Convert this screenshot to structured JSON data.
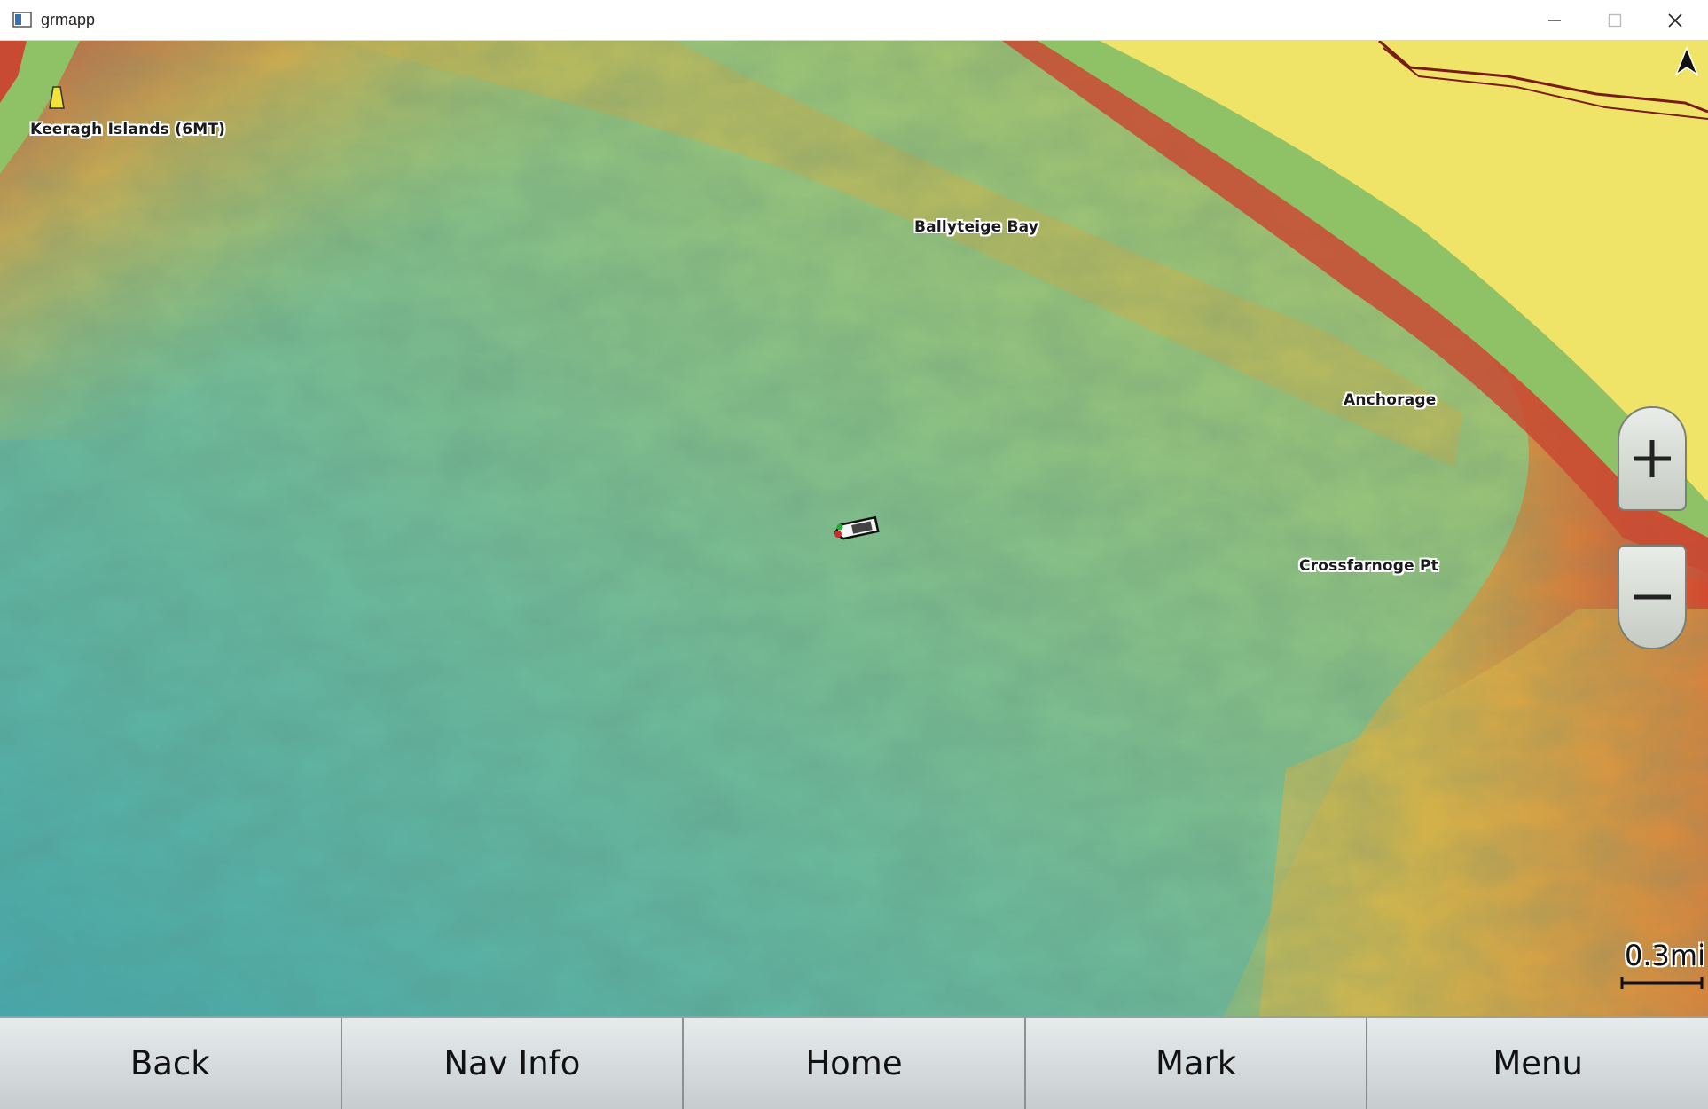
{
  "window": {
    "title": "grmapp",
    "icon": "app-window-icon",
    "controls": [
      "minimize-icon",
      "maximize-icon",
      "close-icon"
    ]
  },
  "map": {
    "labels": {
      "keeragh": "Keeragh Islands (6MT)",
      "ballyteige": "Ballyteige Bay",
      "anchorage": "Anchorage",
      "crossfarnoge": "Crossfarnoge Pt"
    },
    "north_indicator": "north-arrow-icon",
    "vessel": "boat-icon",
    "scale": "0.3mi",
    "colors": {
      "land": "#f0e468",
      "shore": "#8fc267",
      "deep": "#4fb0a6",
      "shallow": "#c5b84a",
      "very_shallow": "#c94a32"
    }
  },
  "toolbar": {
    "back": "Back",
    "nav_info": "Nav Info",
    "home": "Home",
    "mark": "Mark",
    "menu": "Menu"
  }
}
